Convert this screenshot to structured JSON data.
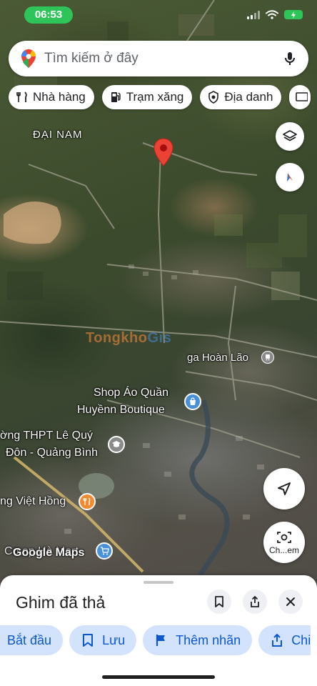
{
  "status_bar": {
    "time": "06:53",
    "battery_icon": "battery-charging-icon"
  },
  "search": {
    "placeholder": "Tìm kiếm ở đây"
  },
  "chips": [
    {
      "label": "Nhà hàng",
      "icon": "fork-knife-icon"
    },
    {
      "label": "Trạm xăng",
      "icon": "gas-pump-icon"
    },
    {
      "label": "Địa danh",
      "icon": "landmark-icon"
    }
  ],
  "map": {
    "area_label": "ĐẠI NAM",
    "station_label": "ga Hoàn Lão",
    "poi_shop": {
      "line1": "Shop Áo Quần",
      "line2": "Huyềnn Boutique"
    },
    "poi_school": {
      "line1": "ờng THPT Lê Quý",
      "line2": "Đôn - Quảng Bình"
    },
    "poi_restaurant": "ng Việt Hồng",
    "poi_store": "Co.op Hà Mart",
    "google_logo": "Google Maps",
    "watermark": {
      "part1": "Tongkho",
      "part2": "Gis"
    },
    "accent_colors": {
      "pin": "#ea4335",
      "poi_orange": "#f28b30",
      "poi_blue": "#4a90d9",
      "status_green": "#2fc45a"
    }
  },
  "controls": {
    "layers_icon": "layers-icon",
    "compass_icon": "compass-icon",
    "location_icon": "navigation-arrow-icon",
    "lens_label": "Ch...em"
  },
  "sheet": {
    "title": "Ghim đã thả",
    "actions": [
      {
        "label": "Bắt đầu",
        "icon": ""
      },
      {
        "label": "Lưu",
        "icon": "bookmark-icon"
      },
      {
        "label": "Thêm nhãn",
        "icon": "flag-icon"
      },
      {
        "label": "Chi",
        "icon": "share-icon"
      }
    ]
  }
}
